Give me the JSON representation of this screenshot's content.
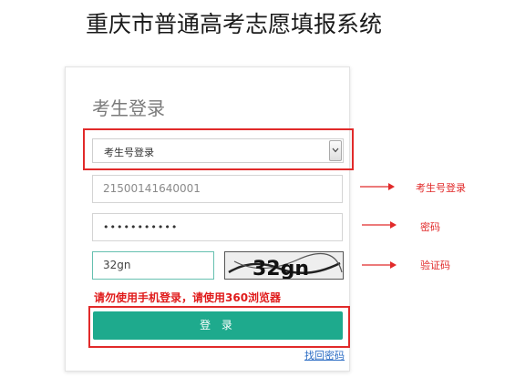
{
  "header": {
    "title": "重庆市普通高考志愿填报系统"
  },
  "login": {
    "title": "考生登录",
    "login_type": {
      "selected": "考生号登录"
    },
    "username": {
      "value": "21500141640001"
    },
    "password": {
      "value": "•••••••••••"
    },
    "captcha": {
      "value": "32gn",
      "image_text": "32gn"
    },
    "warning": "请勿使用手机登录，请使用360浏览器",
    "submit_label": "登 录",
    "forgot_link": "找回密码"
  },
  "annotations": {
    "username_note": "考生号登录",
    "password_note": "密码",
    "captcha_note": "验证码",
    "color": "#e12a2a"
  },
  "colors": {
    "accent_button": "#1eaa8d",
    "warning_text": "#e01b1b",
    "link": "#2b6cc4"
  }
}
